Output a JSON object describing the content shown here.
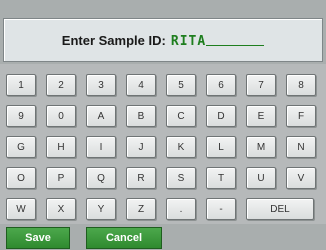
{
  "entry": {
    "prompt": "Enter Sample ID:",
    "value": "RITA"
  },
  "keyboard": {
    "rows": [
      [
        "1",
        "2",
        "3",
        "4",
        "5",
        "6",
        "7",
        "8"
      ],
      [
        "9",
        "0",
        "A",
        "B",
        "C",
        "D",
        "E",
        "F"
      ],
      [
        "G",
        "H",
        "I",
        "J",
        "K",
        "L",
        "M",
        "N"
      ],
      [
        "O",
        "P",
        "Q",
        "R",
        "S",
        "T",
        "U",
        "V"
      ],
      [
        "W",
        "X",
        "Y",
        "Z",
        ".",
        "-",
        "DEL"
      ]
    ]
  },
  "actions": {
    "save_label": "Save",
    "cancel_label": "Cancel"
  },
  "colors": {
    "accent_green": "#3a9a3a",
    "entry_text_green": "#1e7e1e"
  }
}
